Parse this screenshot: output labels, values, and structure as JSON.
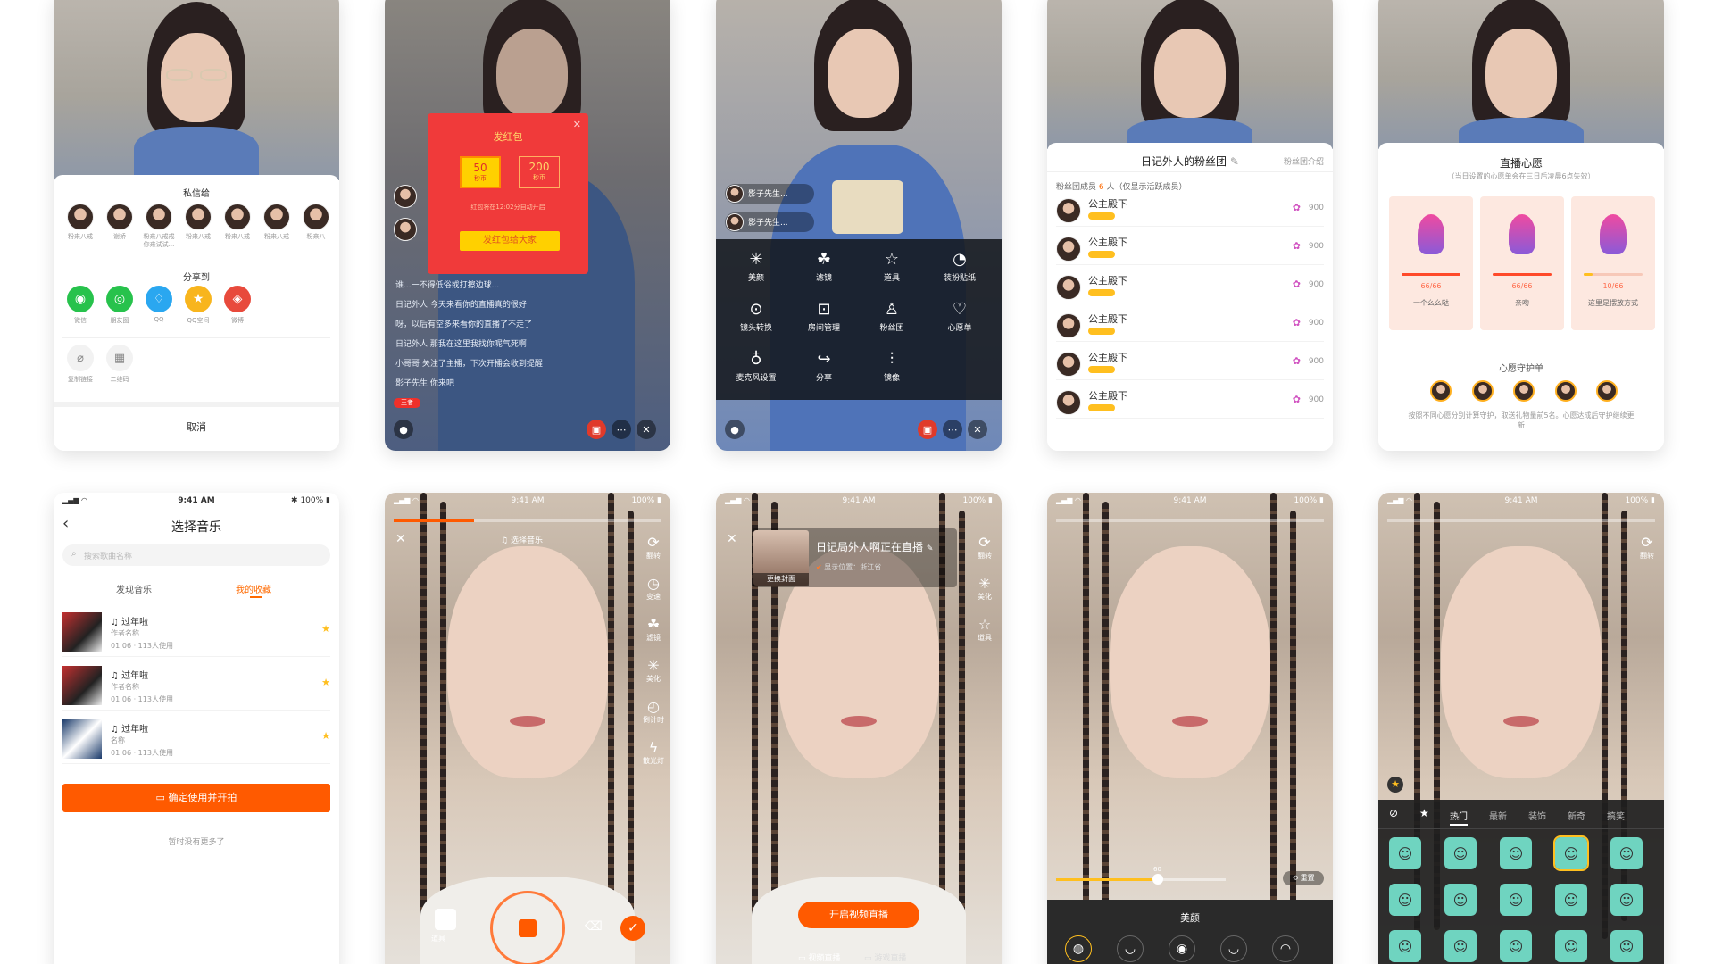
{
  "p1": {
    "private_title": "私信给",
    "contacts": [
      "粉来八戒",
      "谢娇",
      "粉来八戒戒你来试试...",
      "粉来八戒",
      "粉来八戒",
      "粉来八戒",
      "粉来八"
    ],
    "share_title": "分享到",
    "share": [
      {
        "label": "微信",
        "color": "#27c24c",
        "icon": "◉"
      },
      {
        "label": "朋友圈",
        "color": "#27c24c",
        "icon": "◎"
      },
      {
        "label": "QQ",
        "color": "#2aa7f0",
        "icon": "♢"
      },
      {
        "label": "QQ空间",
        "color": "#f8b51d",
        "icon": "★"
      },
      {
        "label": "微博",
        "color": "#e84a3c",
        "icon": "◈"
      }
    ],
    "tools": [
      {
        "label": "复制链接",
        "icon": "⌀"
      },
      {
        "label": "二维码",
        "icon": "▦"
      }
    ],
    "cancel": "取消"
  },
  "p2": {
    "packet_title": "发红包",
    "opt1_value": "50",
    "opt1_unit": "秒币",
    "opt2_value": "200",
    "opt2_unit": "秒币",
    "note": "红包将在12:02分自动开启",
    "send_btn": "发红包给大家",
    "chats": [
      "谁...一不得低俗或打擦边球...",
      "日记外人 今天来看你的直播真的很好",
      "呀，以后有空多来看你的直播了不走了",
      "日记外人 那我在这里我找你呢气死啊",
      "小哥哥 关注了主播，下次开播会收到提醒",
      "影子先生 你来吧"
    ],
    "user_tag": "王者"
  },
  "p3": {
    "viewer1": "影子先生...",
    "viewer2": "影子先生...",
    "menu": [
      {
        "label": "美颜",
        "icon": "✳"
      },
      {
        "label": "滤镜",
        "icon": "☘"
      },
      {
        "label": "道具",
        "icon": "☆"
      },
      {
        "label": "装扮贴纸",
        "icon": "◔"
      },
      {
        "label": "镜头转换",
        "icon": "⊙"
      },
      {
        "label": "房间管理",
        "icon": "⊡"
      },
      {
        "label": "粉丝团",
        "icon": "♙"
      },
      {
        "label": "心愿单",
        "icon": "♡"
      },
      {
        "label": "麦克风设置",
        "icon": "♁"
      },
      {
        "label": "分享",
        "icon": "↪"
      },
      {
        "label": "镜像",
        "icon": "⫶"
      }
    ]
  },
  "p4": {
    "title": "日记外人的粉丝团",
    "intro": "粉丝团介绍",
    "members_label": "粉丝团成员",
    "count": "6",
    "unit": "人",
    "members_note": "（仅显示活跃成员）",
    "fans": [
      {
        "name": "公主殿下",
        "score": "900"
      },
      {
        "name": "公主殿下",
        "score": "900"
      },
      {
        "name": "公主殿下",
        "score": "900"
      },
      {
        "name": "公主殿下",
        "score": "900"
      },
      {
        "name": "公主殿下",
        "score": "900"
      },
      {
        "name": "公主殿下",
        "score": "900"
      }
    ]
  },
  "p5": {
    "title": "直播心愿",
    "subtitle": "（当日设置的心愿单会在三日后凌晨6点失效）",
    "wishes": [
      {
        "progress": "66/66",
        "name": "一个么么哒",
        "fill": 1.0
      },
      {
        "progress": "66/66",
        "name": "亲吻",
        "fill": 1.0
      },
      {
        "progress": "10/66",
        "name": "这里是摆放方式",
        "fill": 0.15
      }
    ],
    "guard_title": "心愿守护单",
    "footer": "按照不同心愿分别计算守护，取送礼物量前5名。心愿达成后守护继续更新"
  },
  "p6": {
    "time": "9:41 AM",
    "battery": "100%",
    "title": "选择音乐",
    "search_placeholder": "搜索歌曲名称",
    "tab1": "发现音乐",
    "tab2": "我的收藏",
    "songs": [
      {
        "title": "过年啦",
        "author": "作者名称",
        "meta": "01:06 · 113人使用"
      },
      {
        "title": "过年啦",
        "author": "作者名称",
        "meta": "01:06 · 113人使用"
      },
      {
        "title": "过年啦",
        "author": "名称",
        "meta": "01:06 · 113人使用"
      }
    ],
    "confirm": "确定使用并开拍",
    "end_note": "暂时没有更多了"
  },
  "p7": {
    "time": "9:41 AM",
    "battery": "100%",
    "music": "选择音乐",
    "side": [
      {
        "label": "翻转",
        "icon": "⟳"
      },
      {
        "label": "变速",
        "icon": "◷"
      },
      {
        "label": "滤镜",
        "icon": "☘"
      },
      {
        "label": "美化",
        "icon": "✳"
      },
      {
        "label": "倒计时",
        "icon": "◴"
      },
      {
        "label": "散光灯",
        "icon": "ϟ"
      }
    ],
    "props": "道具",
    "record_progress": 0.3
  },
  "p8": {
    "time": "9:41 AM",
    "battery": "100%",
    "cover_label": "更换封面",
    "room_title": "日记局外人啊正在直播",
    "location": "显示位置：浙江省",
    "side": [
      {
        "label": "翻转",
        "icon": "⟳"
      },
      {
        "label": "美化",
        "icon": "✳"
      },
      {
        "label": "道具",
        "icon": "☆"
      }
    ],
    "start": "开启视频直播",
    "mode1": "视频直播",
    "mode2": "游戏直播"
  },
  "p9": {
    "time": "9:41 AM",
    "battery": "100%",
    "slider_value": "60",
    "slider_fill": 0.6,
    "reset": "重置",
    "panel_title": "美颜",
    "icons": [
      "◍",
      "◡",
      "◉",
      "◡",
      "◠"
    ]
  },
  "p10": {
    "time": "9:41 AM",
    "battery": "100%",
    "side": [
      {
        "label": "翻转",
        "icon": "⟳"
      }
    ],
    "tabs": [
      "热门",
      "最新",
      "装饰",
      "新奇",
      "搞笑"
    ],
    "active_tab": "热门"
  }
}
